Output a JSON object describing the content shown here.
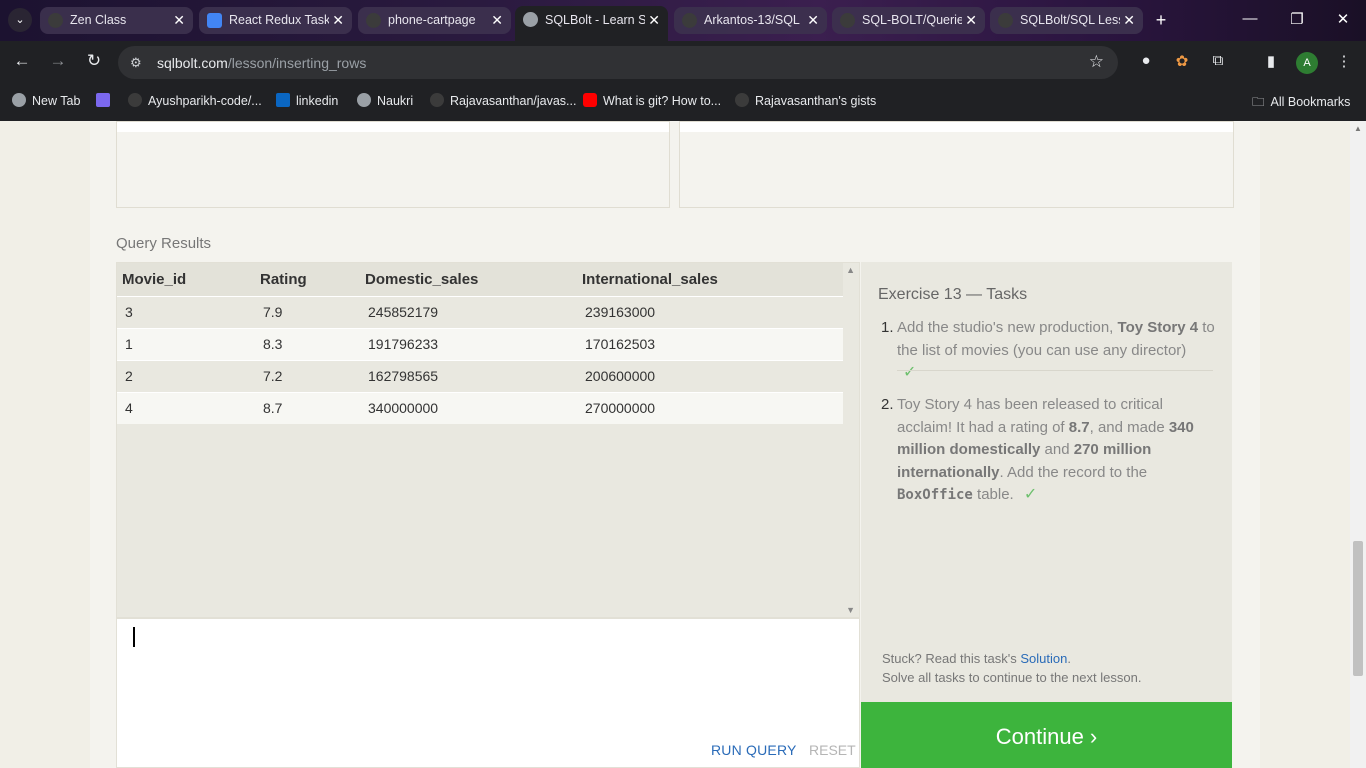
{
  "browser": {
    "tabs": [
      {
        "title": "Zen Class",
        "favicon_color": "#3b3b3b",
        "active": false
      },
      {
        "title": "React Redux Task",
        "favicon_color": "#4285f4",
        "active": false
      },
      {
        "title": "phone-cartpage",
        "favicon_color": "#3b3b3b",
        "active": false
      },
      {
        "title": "SQLBolt - Learn SQL",
        "favicon_color": "#9aa0a6",
        "active": true
      },
      {
        "title": "Arkantos-13/SQL",
        "favicon_color": "#3b3b3b",
        "active": false
      },
      {
        "title": "SQL-BOLT/Queries",
        "favicon_color": "#3b3b3b",
        "active": false
      },
      {
        "title": "SQLBolt/SQL Lesson",
        "favicon_color": "#3b3b3b",
        "active": false
      }
    ],
    "url_host": "sqlbolt.com",
    "url_path": "/lesson/inserting_rows",
    "avatar_letter": "A",
    "bookmarks": [
      {
        "label": "New Tab",
        "icon_color": "#9aa0a6"
      },
      {
        "label": "",
        "icon_color": "#7b68ee"
      },
      {
        "label": "Ayushparikh-code/...",
        "icon_color": "#3b3b3b"
      },
      {
        "label": "linkedin",
        "icon_color": "#0a66c2"
      },
      {
        "label": "Naukri",
        "icon_color": "#9aa0a6"
      },
      {
        "label": "Rajavasanthan/javas...",
        "icon_color": "#3b3b3b"
      },
      {
        "label": "What is git? How to...",
        "icon_color": "#ff0000"
      },
      {
        "label": "Rajavasanthan's gists",
        "icon_color": "#3b3b3b"
      }
    ],
    "all_bookmarks": "All Bookmarks"
  },
  "results": {
    "label": "Query Results",
    "columns": [
      "Movie_id",
      "Rating",
      "Domestic_sales",
      "International_sales"
    ],
    "rows": [
      [
        "3",
        "7.9",
        "245852179",
        "239163000"
      ],
      [
        "1",
        "8.3",
        "191796233",
        "170162503"
      ],
      [
        "2",
        "7.2",
        "162798565",
        "200600000"
      ],
      [
        "4",
        "8.7",
        "340000000",
        "270000000"
      ]
    ]
  },
  "editor": {
    "run_label": "RUN QUERY",
    "reset_label": "RESET"
  },
  "exercise": {
    "title": "Exercise 13 — Tasks",
    "task1": {
      "num": "1.",
      "pre": "Add the studio's new production, ",
      "bold": "Toy Story 4",
      "post": " to the list of movies (you can use any director)",
      "check": "✓"
    },
    "task2": {
      "num": "2.",
      "p1": "Toy Story 4 has been released to critical acclaim! It had a rating of ",
      "b1": "8.7",
      "p2": ", and made ",
      "b2": "340 million domestically",
      "p3": " and ",
      "b3": "270 million internationally",
      "p4": ". Add the record to the ",
      "code": "BoxOffice",
      "p5": " table.",
      "check": "✓"
    },
    "stuck_pre": "Stuck? Read this task's ",
    "solution_link": "Solution",
    "stuck_post": ".",
    "continue_note": "Solve all tasks to continue to the next lesson.",
    "continue_label": "Continue ›"
  },
  "colors": {
    "accent_blue": "#2a6bb8",
    "continue_green": "#3db43d",
    "check_green": "#6ec06e"
  }
}
